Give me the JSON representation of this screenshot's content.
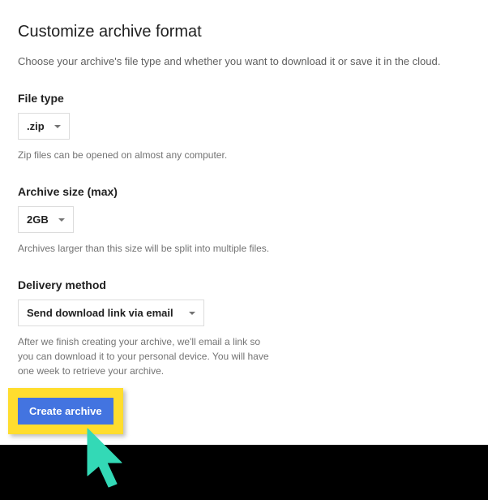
{
  "header": {
    "title": "Customize archive format",
    "description": "Choose your archive's file type and whether you want to download it or save it in the cloud."
  },
  "fields": {
    "filetype": {
      "label": "File type",
      "value": ".zip",
      "helper": "Zip files can be opened on almost any computer."
    },
    "archivesize": {
      "label": "Archive size (max)",
      "value": "2GB",
      "helper": "Archives larger than this size will be split into multiple files."
    },
    "delivery": {
      "label": "Delivery method",
      "value": "Send download link via email",
      "helper": "After we finish creating your archive, we'll email a link so you can download it to your personal device. You will have one week to retrieve your archive."
    }
  },
  "actions": {
    "create_label": "Create archive"
  },
  "annotation": {
    "highlight_color": "#ffdd2e",
    "cursor_color": "#33d9b6"
  }
}
